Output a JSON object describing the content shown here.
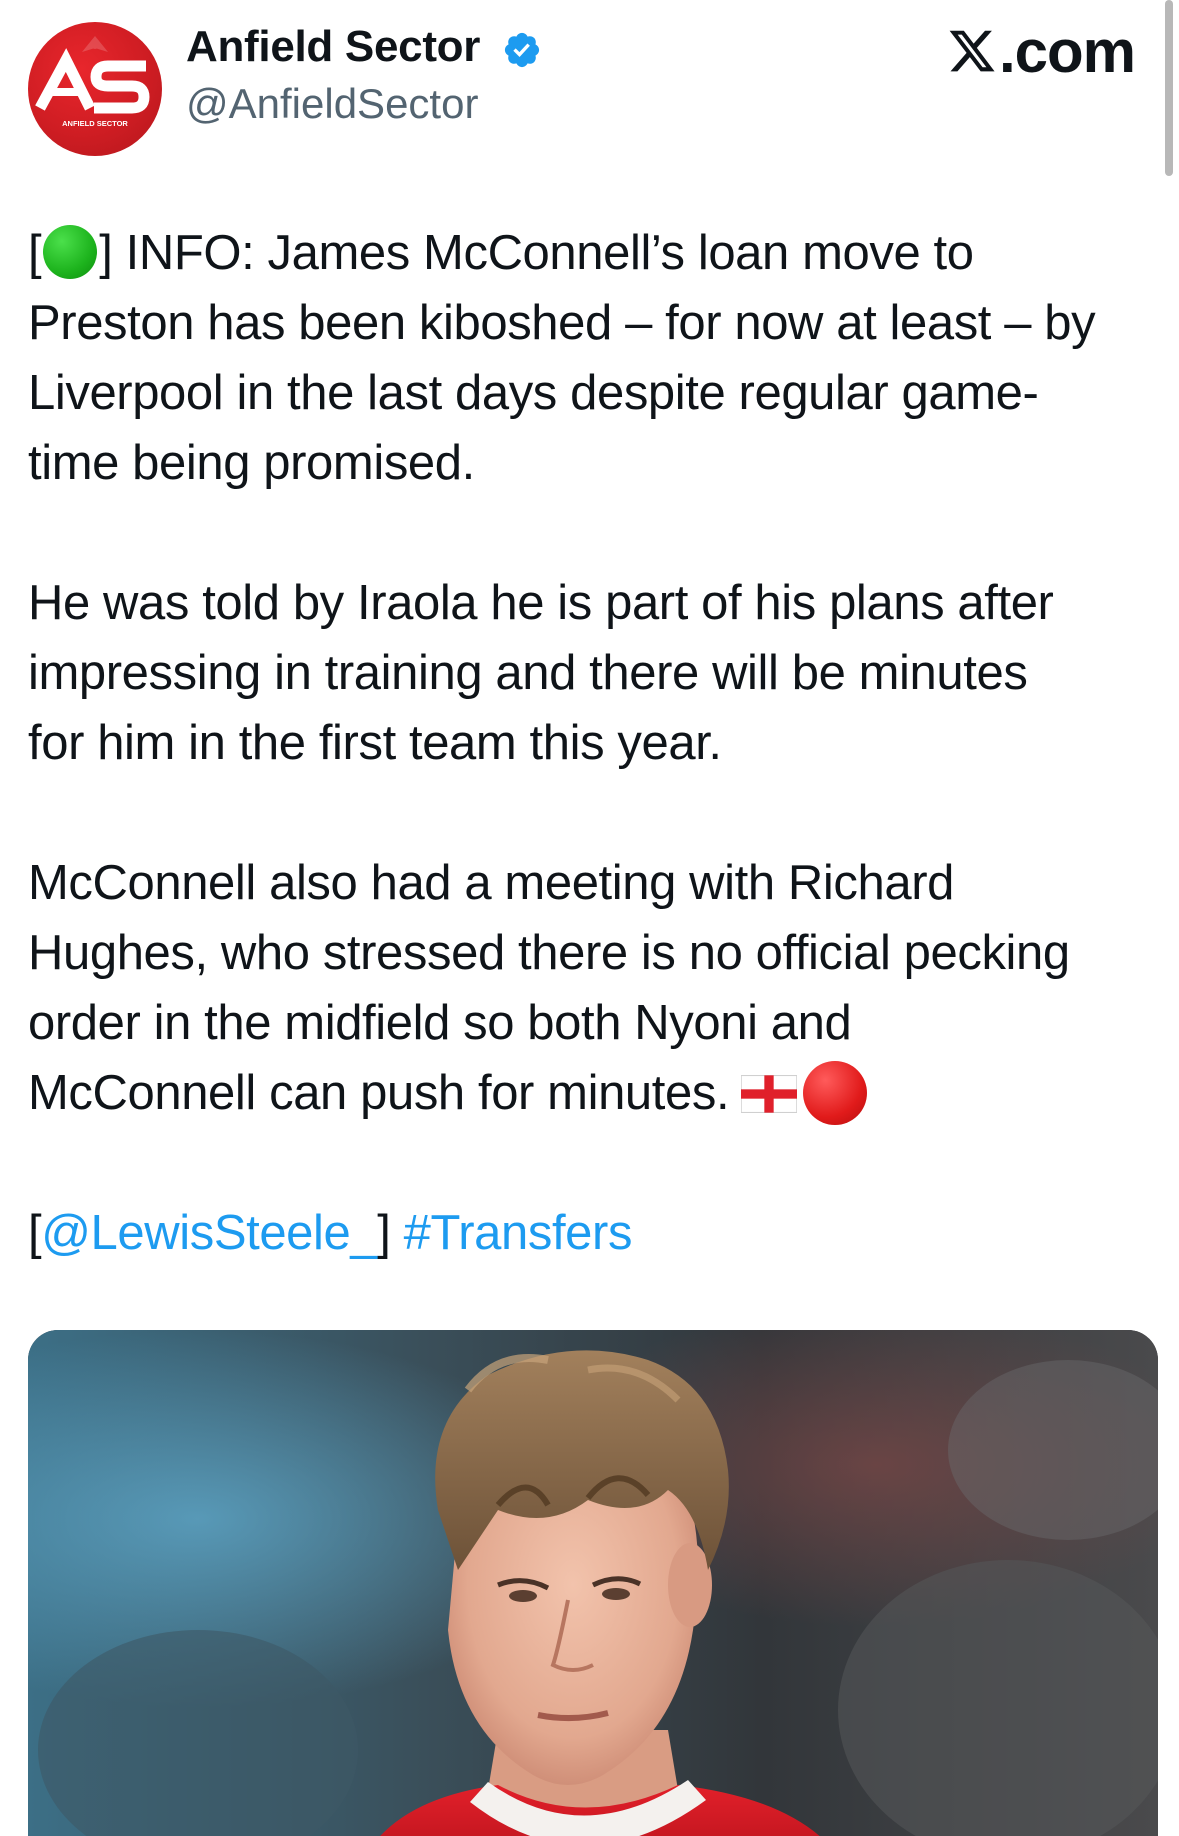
{
  "header": {
    "avatar_text": "AS",
    "avatar_subtext": "ANFIELD SECTOR",
    "display_name": "Anfield Sector",
    "handle": "@AnfieldSector",
    "verified_icon": "verified-badge-icon",
    "site_label": ".com",
    "site_logo_icon": "x-logo-icon"
  },
  "tweet": {
    "p1": {
      "l1_open": "[",
      "l1_text": "] INFO: James McConnell’s loan move to",
      "l2": "Preston has been kiboshed – for now at least – by",
      "l3": "Liverpool in the last days despite regular game-",
      "l4": "time being promised."
    },
    "p2": {
      "l1": "He was told by Iraola he is part of his plans after",
      "l2": "impressing in training and there will be minutes",
      "l3": "for him in the first team this year."
    },
    "p3": {
      "l1": "McConnell also had a meeting with Richard",
      "l2": "Hughes, who stressed there is no official pecking",
      "l3": "order in the midfield so both Nyoni and",
      "l4": "McConnell can push for minutes."
    },
    "p4": {
      "bracket_open": "[",
      "mention": "@LewisSteele_",
      "bracket_close": "] ",
      "hashtag": "#Transfers"
    },
    "icons": [
      "green-circle-icon",
      "england-flag-icon",
      "red-circle-icon"
    ]
  },
  "media": {
    "icon": "player-photo"
  },
  "colors": {
    "accent": "#1d9bf0",
    "text": "#0f1419",
    "secondary": "#536471",
    "avatar_red": "#cf1d23"
  }
}
